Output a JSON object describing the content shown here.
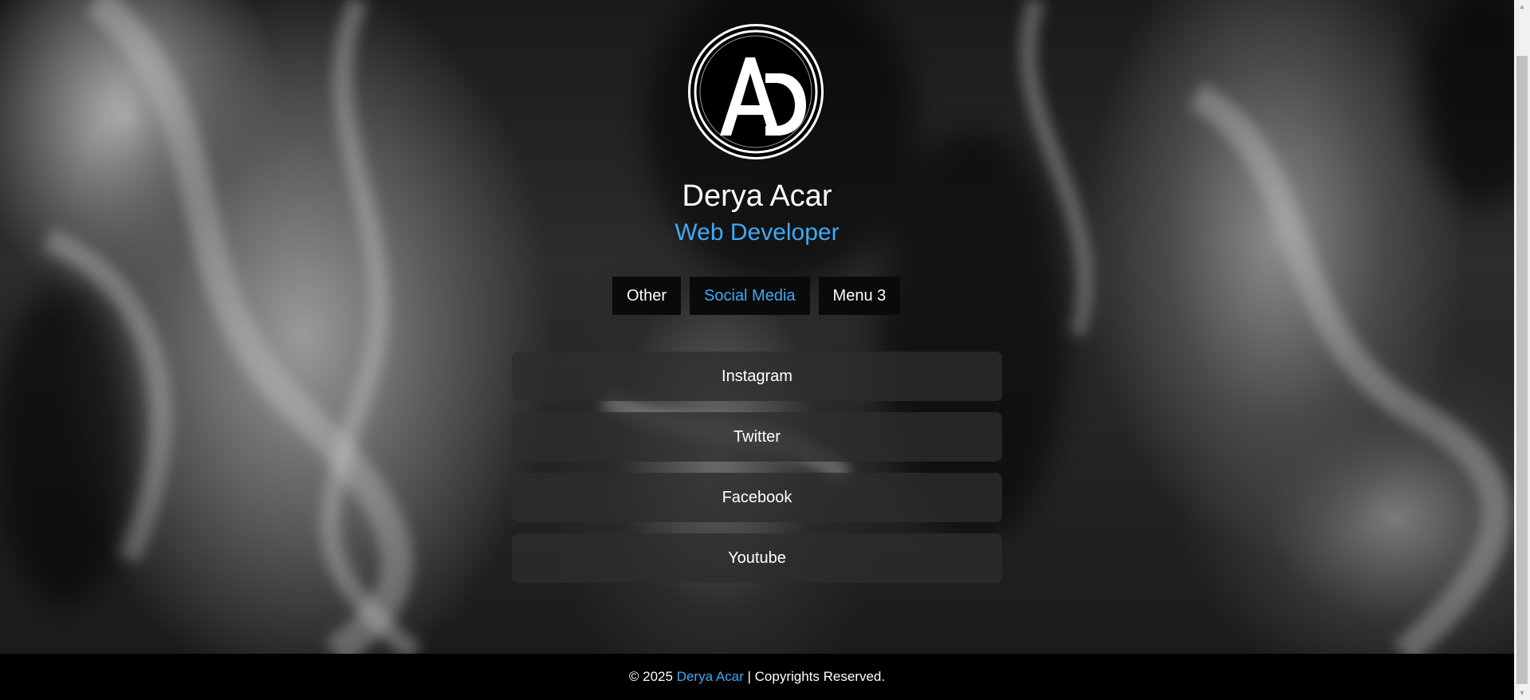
{
  "profile": {
    "logo_letters": "AD",
    "name": "Derya Acar",
    "role": "Web Developer"
  },
  "tabs": [
    {
      "label": "Other",
      "active": false
    },
    {
      "label": "Social Media",
      "active": true
    },
    {
      "label": "Menu 3",
      "active": false
    }
  ],
  "links": [
    {
      "label": "Instagram"
    },
    {
      "label": "Twitter"
    },
    {
      "label": "Facebook"
    },
    {
      "label": "Youtube"
    }
  ],
  "footer": {
    "prefix": "© 2025 ",
    "name": "Derya Acar",
    "suffix": " | Copyrights Reserved."
  },
  "colors": {
    "accent": "#3fa9f5",
    "tab_bg": "#0a0a0a",
    "link_bg": "rgba(45,45,45,0.78)",
    "footer_bg": "#000000"
  }
}
